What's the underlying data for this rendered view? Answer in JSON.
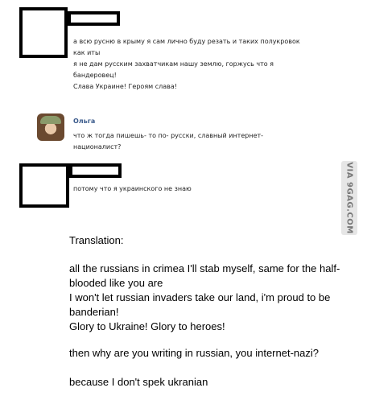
{
  "comment1": {
    "lines": [
      "а всю русню в крыму я сам лично буду резать и таких полукровок",
      "как иты",
      "я не дам русским захватчикам нашу землю, горжусь что я",
      "бандеровец!",
      "Слава Украине! Героям слава!"
    ]
  },
  "comment2": {
    "author": "Ольга",
    "lines": [
      "что ж тогда пишешь- то по- русски, славный интернет-",
      "националист?"
    ]
  },
  "comment3": {
    "lines": [
      "потому что я украинского не знаю"
    ]
  },
  "watermark": "VIA 9GAG.COM",
  "translation": {
    "heading": "Translation:",
    "p1": [
      "all the russians in crimea I'll stab myself, same for the half-",
      "blooded like you are",
      "I won't let russian invaders take our land, i'm proud to be",
      "banderian!",
      "Glory to Ukraine! Glory to heroes!"
    ],
    "p2": "then why are you writing in russian, you internet-nazi?",
    "p3": "because I don't spek ukranian"
  }
}
